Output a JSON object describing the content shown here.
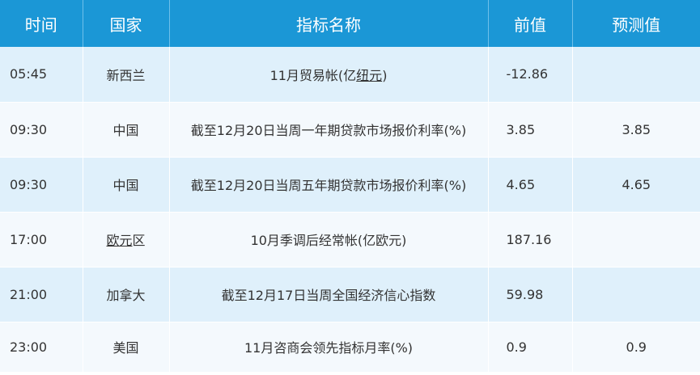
{
  "headers": [
    "时间",
    "国家",
    "指标名称",
    "前值",
    "预测值"
  ],
  "rows": [
    {
      "time": "05:45",
      "country": "新西兰",
      "indicator_prefix": "11月贸易帐(亿",
      "indicator_link": "纽元",
      "indicator_suffix": ")",
      "previous": "-12.86",
      "forecast": ""
    },
    {
      "time": "09:30",
      "country": "中国",
      "indicator": "截至12月20日当周一年期贷款市场报价利率(%)",
      "previous": "3.85",
      "forecast": "3.85"
    },
    {
      "time": "09:30",
      "country": "中国",
      "indicator": "截至12月20日当周五年期贷款市场报价利率(%)",
      "previous": "4.65",
      "forecast": "4.65"
    },
    {
      "time": "17:00",
      "country_link": "欧元",
      "country_suffix": "区",
      "indicator": "10月季调后经常帐(亿欧元)",
      "previous": "187.16",
      "forecast": ""
    },
    {
      "time": "21:00",
      "country": "加拿大",
      "indicator": "截至12月17日当周全国经济信心指数",
      "previous": "59.98",
      "forecast": ""
    },
    {
      "time": "23:00",
      "country": "美国",
      "indicator": "11月咨商会领先指标月率(%)",
      "previous": "0.9",
      "forecast": "0.9"
    }
  ]
}
